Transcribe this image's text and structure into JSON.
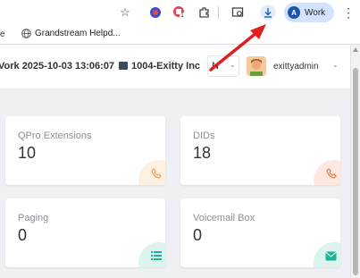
{
  "browser": {
    "profile_label": "Work",
    "profile_initial": "A",
    "badge_count": "1",
    "bookmark_label": "Grandstream Helpd..."
  },
  "header": {
    "datetime": "Vork 2025-10-03 13:06:07",
    "tenant": "1004-Exitty Inc",
    "lang_partial": "N",
    "username": "exittyadmin"
  },
  "cards": [
    {
      "title": "QPro Extensions",
      "value": "10",
      "icon": "phone-icon",
      "color": "#f0a050",
      "tint": "#fdf1e4"
    },
    {
      "title": "DIDs",
      "value": "18",
      "icon": "phone-icon",
      "color": "#ec7a4a",
      "tint": "#fde9e1"
    },
    {
      "title": "Paging",
      "value": "0",
      "icon": "list-icon",
      "color": "#1fb39a",
      "tint": "#dcf3ee"
    },
    {
      "title": "Voicemail Box",
      "value": "0",
      "icon": "mail-icon",
      "color": "#1fb39a",
      "tint": "#dcf3ee"
    }
  ],
  "annotation_color": "#e02020"
}
